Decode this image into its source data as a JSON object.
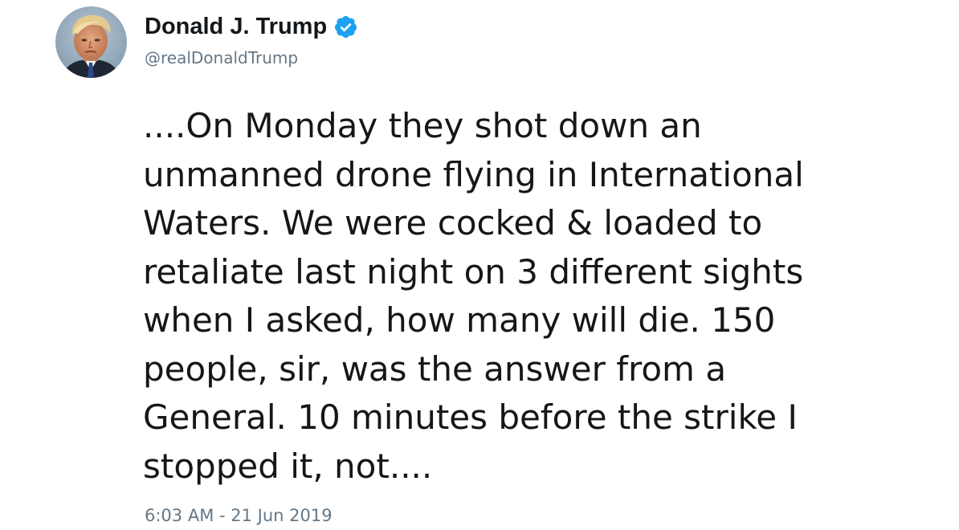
{
  "author": {
    "display_name": "Donald J. Trump",
    "handle": "@realDonaldTrump",
    "verified": true,
    "verified_icon": "verified-badge-icon",
    "avatar_icon": "profile-photo"
  },
  "tweet": {
    "text": "....On Monday they shot down an\nunmanned drone flying in International\nWaters. We were cocked & loaded to\nretaliate last night on 3 different sights\nwhen I asked, how many will die. 150\npeople, sir, was the answer from a\nGeneral. 10 minutes before the strike I\nstopped it, not....",
    "timestamp": "6:03 AM - 21 Jun 2019"
  },
  "colors": {
    "text_primary": "#14171a",
    "text_secondary": "#657786",
    "verified_blue": "#1da1f2",
    "background": "#ffffff"
  }
}
